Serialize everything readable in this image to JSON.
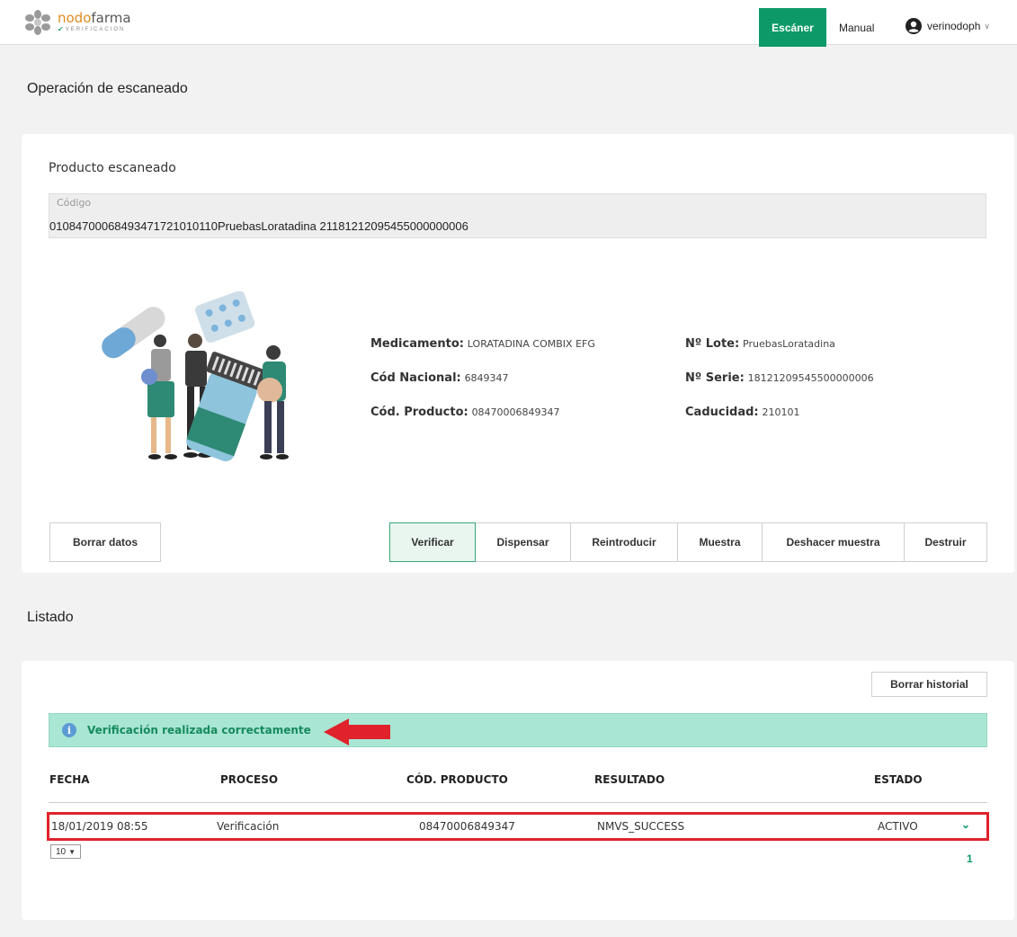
{
  "header": {
    "brand_part1": "nodo",
    "brand_part2": "farma",
    "brand_sub": "VERIFICACION",
    "nav_scan": "Escáner",
    "nav_manual": "Manual",
    "username": "verinodoph",
    "user_icon": "user-circle-icon",
    "accent_color": "#0d9a68"
  },
  "scan": {
    "page_title": "Operación de escaneado",
    "card_title": "Producto escaneado",
    "code_label": "Código",
    "code_value": "0108470006849347172101011​0PruebasLoratadina 21181212095455000000006",
    "info_left": [
      {
        "key": "Medicamento:",
        "value": "LORATADINA COMBIX EFG"
      },
      {
        "key": "Cód Nacional:",
        "value": "6849347"
      },
      {
        "key": "Cód. Producto:",
        "value": "08470006849347"
      }
    ],
    "info_right": [
      {
        "key": "Nº Lote:",
        "value": "PruebasLoratadina"
      },
      {
        "key": "Nº Serie:",
        "value": "18121209545500000006"
      },
      {
        "key": "Caducidad:",
        "value": "210101"
      }
    ],
    "btn_clear": "Borrar datos",
    "actions": [
      "Verificar",
      "Dispensar",
      "Reintroducir",
      "Muestra",
      "Deshacer muestra",
      "Destruir"
    ]
  },
  "listado": {
    "title": "Listado",
    "btn_clear_history": "Borrar historial",
    "alert_text": "Verificación realizada correctamente",
    "alert_icon": "info-icon",
    "alert_color": "#a9e6d3",
    "columns": [
      "FECHA",
      "PROCESO",
      "CÓD. PRODUCTO",
      "RESULTADO",
      "ESTADO"
    ],
    "rows": [
      {
        "fecha": "18/01/2019 08:55",
        "proceso": "Verificación",
        "cod_producto": "08470006849347",
        "resultado": "NMVS_SUCCESS",
        "estado": "ACTIVO"
      }
    ],
    "page_size": "10",
    "page_number": "1",
    "highlight_color": "#e0222c"
  }
}
